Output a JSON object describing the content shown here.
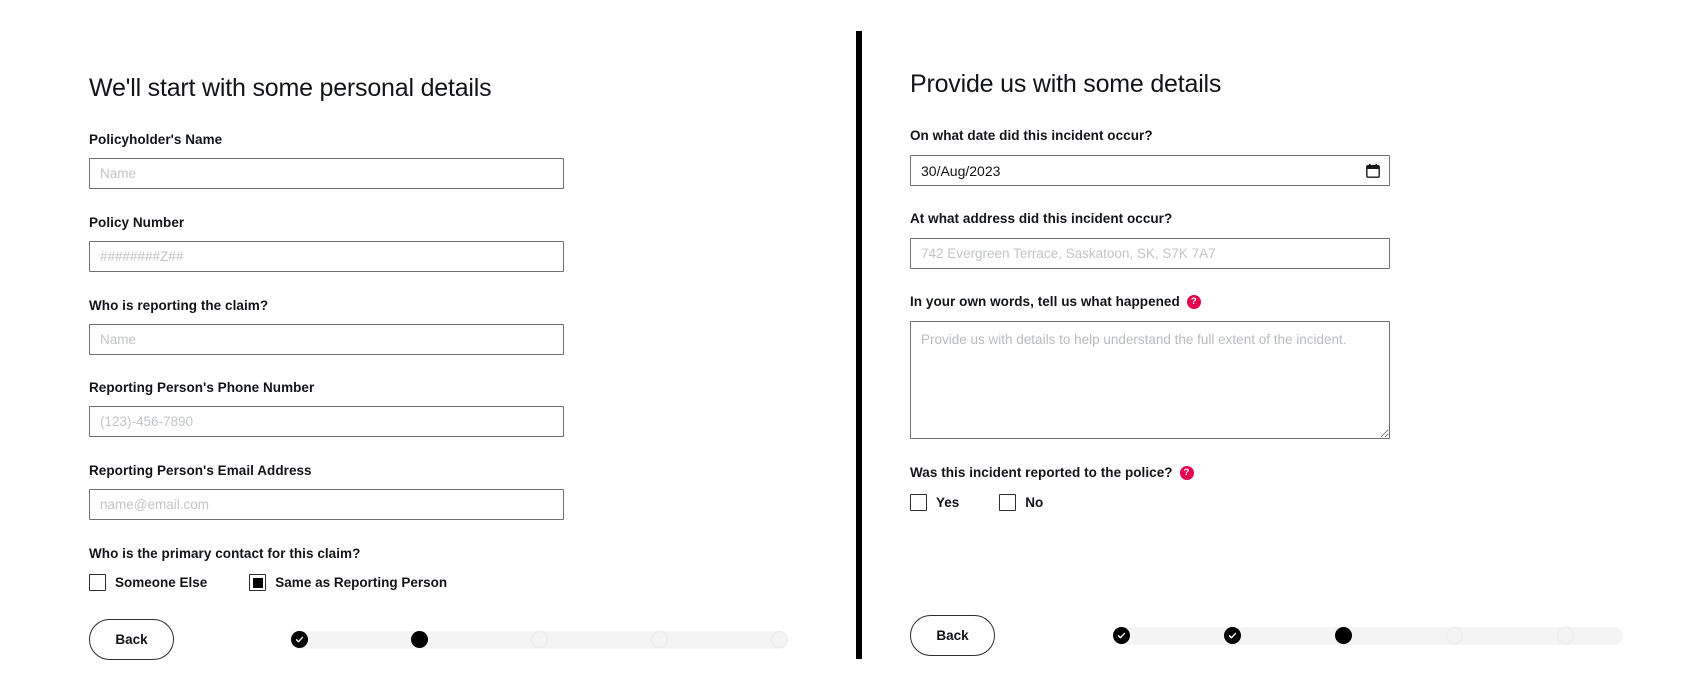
{
  "theme": {
    "accent_pink": "#e4004c",
    "divider_color": "#000000",
    "border_color": "#6f7174",
    "progress_track": "#f4f4f4",
    "text_color": "#12141a",
    "placeholder_color": "#c2c4c7"
  },
  "left_panel": {
    "heading": "We'll start with some personal details",
    "fields": [
      {
        "label": "Policyholder's Name",
        "placeholder": "Name",
        "value": ""
      },
      {
        "label": "Policy Number",
        "placeholder": "########Z##",
        "value": ""
      },
      {
        "label": "Who is reporting the claim?",
        "placeholder": "Name",
        "value": ""
      },
      {
        "label": "Reporting Person's Phone Number",
        "placeholder": "(123)-456-7890",
        "value": ""
      },
      {
        "label": "Reporting Person's Email Address",
        "placeholder": "name@email.com",
        "value": ""
      }
    ],
    "contact_question": "Who is the primary contact for this claim?",
    "contact_options": [
      {
        "label": "Someone Else",
        "checked": false
      },
      {
        "label": "Same as Reporting Person",
        "checked": true
      }
    ],
    "back_label": "Back",
    "progress": {
      "total_steps": 5,
      "states": [
        "done",
        "current",
        "todo",
        "todo",
        "todo"
      ]
    }
  },
  "right_panel": {
    "heading": "Provide us with some details",
    "date_question": "On what date did this incident occur?",
    "date_value": "30/Aug/2023",
    "date_icon": "calendar-icon",
    "address_question": "At what address did this incident occur?",
    "address_placeholder": "742 Evergreen Terrace, Saskatoon, SK, S7K 7A7",
    "address_value": "",
    "story_question": "In your own words, tell us what happened",
    "story_help_icon": "help-icon",
    "story_help_glyph": "?",
    "story_placeholder": "Provide us with details to help understand the full extent of the incident.",
    "story_value": "",
    "police_question": "Was this incident reported to the police?",
    "police_help_icon": "help-icon",
    "police_help_glyph": "?",
    "police_options": [
      {
        "label": "Yes",
        "checked": false
      },
      {
        "label": "No",
        "checked": false
      }
    ],
    "back_label": "Back",
    "progress": {
      "total_steps": 5,
      "states": [
        "done",
        "done",
        "current",
        "todo",
        "todo"
      ]
    }
  }
}
